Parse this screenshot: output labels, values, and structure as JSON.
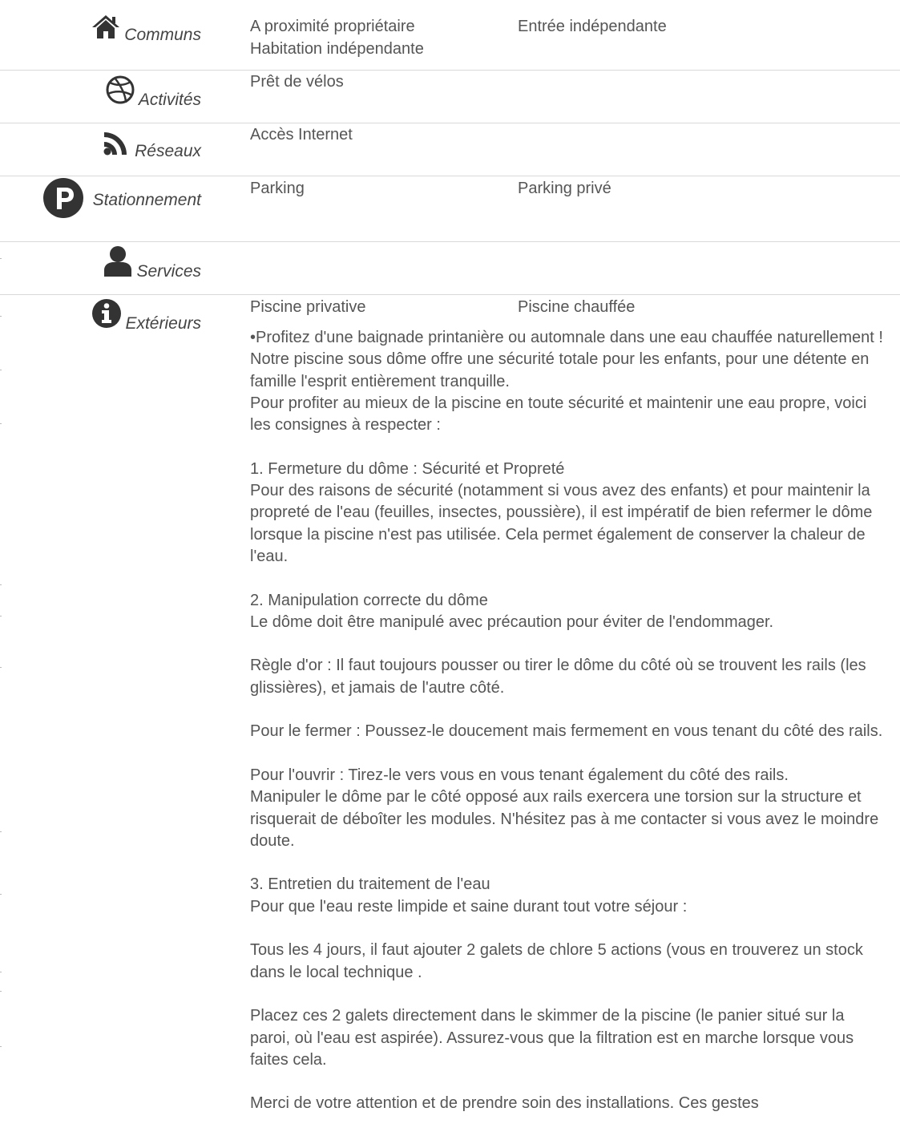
{
  "sections": {
    "communs": {
      "label": "Communs",
      "icon": "home-icon",
      "items": [
        "A proximité propriétaire",
        "Habitation indépendante",
        "Entrée indépendante"
      ]
    },
    "activites": {
      "label": "Activités",
      "icon": "dribbble-ball-icon",
      "items": [
        "Prêt de vélos"
      ]
    },
    "reseaux": {
      "label": "Réseaux",
      "icon": "rss-icon",
      "items": [
        "Accès Internet"
      ]
    },
    "stationnement": {
      "label": "Stationnement",
      "icon": "parking-icon",
      "items": [
        "Parking",
        "Parking privé"
      ]
    },
    "services": {
      "label": "Services",
      "icon": "user-icon",
      "items": []
    },
    "exterieurs": {
      "label": "Extérieurs",
      "icon": "info-icon",
      "items": [
        "Piscine privative",
        "Piscine chauffée"
      ],
      "description": [
        "•Profitez d'une baignade printanière ou automnale dans une eau chauffée naturellement ! Notre piscine sous dôme offre une sécurité totale pour les enfants, pour une détente en famille l'esprit entièrement tranquille.",
        "Pour profiter au mieux de la piscine en toute sécurité et maintenir une eau propre, voici les consignes à respecter :",
        "",
        "1. Fermeture du dôme : Sécurité et Propreté",
        "Pour des raisons de sécurité (notamment si vous avez des enfants) et pour maintenir la propreté de l'eau (feuilles, insectes, poussière), il est impératif de bien refermer le dôme lorsque la piscine n'est pas utilisée. Cela permet également de conserver la chaleur de l'eau.",
        "",
        "2. Manipulation correcte du dôme",
        "Le dôme doit être manipulé avec précaution pour éviter de l'endommager.",
        "",
        "Règle d'or : Il faut toujours pousser ou tirer le dôme du côté où se trouvent les rails (les glissières), et jamais de l'autre côté.",
        "",
        "Pour le fermer : Poussez-le doucement mais fermement en vous tenant du côté des rails.",
        "",
        "Pour l'ouvrir : Tirez-le vers vous en vous tenant également du côté des rails.",
        "Manipuler le dôme par le côté opposé aux rails exercera une torsion sur la structure et risquerait de déboîter les modules. N'hésitez pas à me contacter si vous avez le moindre doute.",
        "",
        "3. Entretien du traitement de l'eau",
        "Pour que l'eau reste limpide et saine durant tout votre séjour :",
        "",
        "Tous les 4 jours, il faut ajouter 2 galets de chlore 5 actions (vous en trouverez un stock dans le local technique .",
        "",
        "Placez ces 2 galets directement dans le skimmer de la piscine (le panier situé sur la paroi, où l'eau est aspirée). Assurez-vous que la filtration est en marche lorsque vous faites cela.",
        "",
        "Merci de votre attention et de prendre soin des installations. Ces gestes"
      ]
    }
  }
}
